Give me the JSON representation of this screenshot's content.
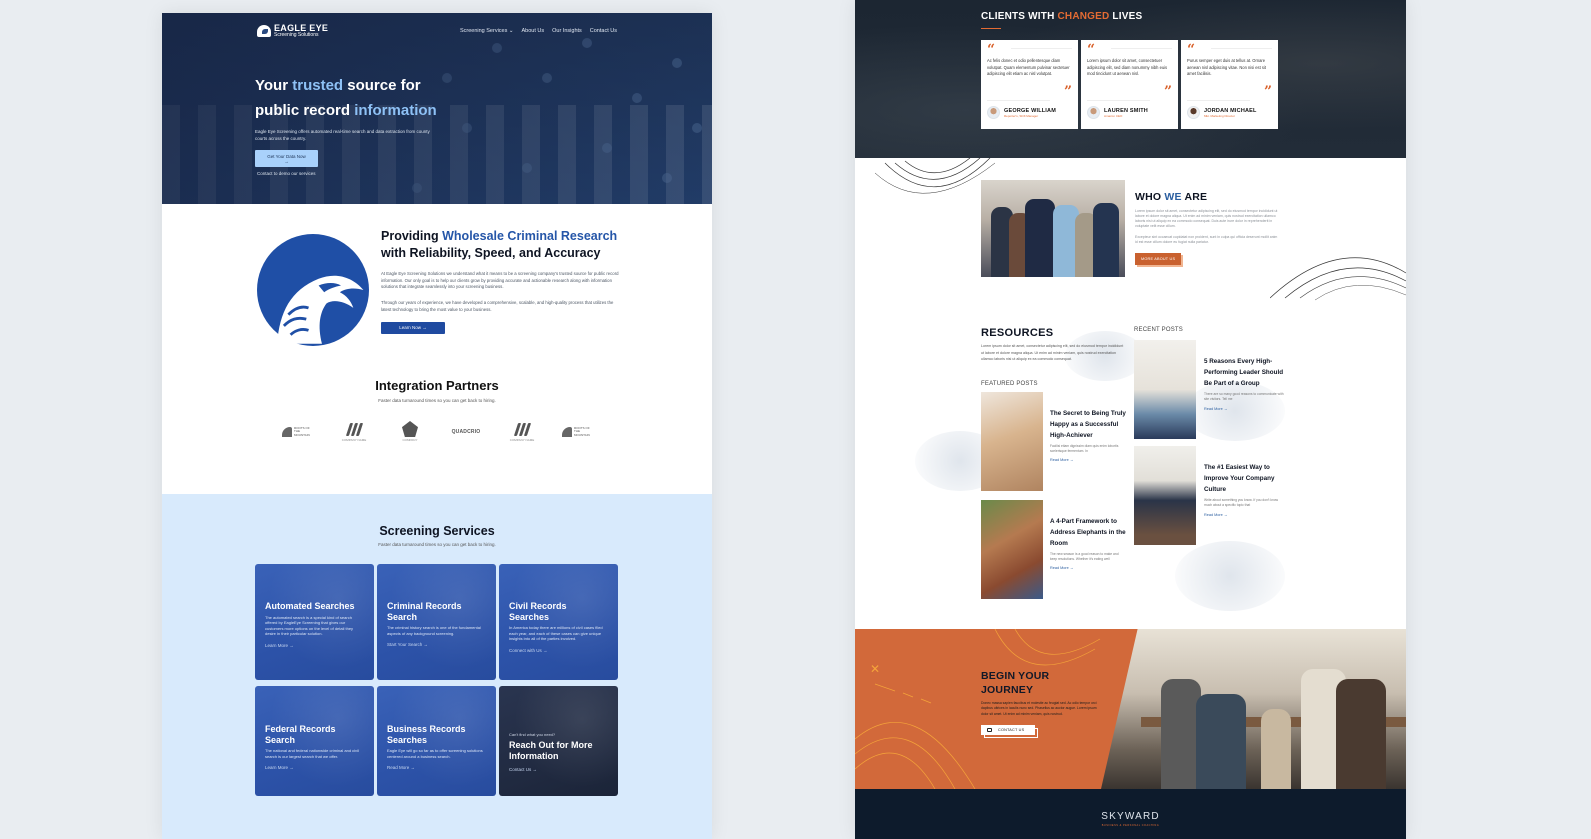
{
  "left_site": {
    "brand": {
      "name": "EAGLE EYE",
      "tagline": "Screening Solutions"
    },
    "nav": [
      {
        "label": "Screening Services",
        "icon": "chevron-down-icon"
      },
      {
        "label": "About Us"
      },
      {
        "label": "Our Insights"
      },
      {
        "label": "Contact Us"
      }
    ],
    "hero": {
      "title_parts": [
        "Your ",
        "trusted",
        " source for",
        "public record ",
        "information"
      ],
      "description": "Eagle Eye Screening offers automated real-time search and data extraction from county courts across the country.",
      "cta_label": "Get Your Data Now →",
      "sub_link": "Contact to demo our services"
    },
    "about": {
      "title_parts": [
        "Providing ",
        "Wholesale Criminal Research",
        "with Reliability, Speed, and Accuracy"
      ],
      "paragraph1": "At Eagle Eye Screening Solutions we understand what it means to be a screening company's trusted source for public record information. Our only goal is to help our clients grow by providing accurate and actionable research along with information solutions that integrate seamlessly into your screening business.",
      "paragraph2": "Through our years of experience, we have developed a comprehensive, scalable, and high-quality process that utilizes the latest technology to bring the most value to your business.",
      "cta_label": "Learn Now →"
    },
    "partners": {
      "title": "Integration Partners",
      "subtitle": "Faster data turnaround times so you can get back to hiring.",
      "logos": [
        {
          "name": "Roots of the Mountain",
          "caption": "ROOTS OF THE MOUNTAIN",
          "kind": "mountain"
        },
        {
          "name": "Partner Slash",
          "caption": "company name",
          "kind": "slash"
        },
        {
          "name": "Pentagon",
          "caption": "company",
          "kind": "pentagon"
        },
        {
          "name": "Quadcrio",
          "caption": "QUADCRIO",
          "kind": "word"
        },
        {
          "name": "Partner Slash 2",
          "caption": "company name",
          "kind": "slash"
        },
        {
          "name": "Roots of the Mountain 2",
          "caption": "ROOTS OF THE MOUNTAIN",
          "kind": "mountain"
        }
      ]
    },
    "services": {
      "title": "Screening Services",
      "subtitle": "Faster data turnaround times so you can get back to hiring.",
      "cards": [
        {
          "title": "Automated Searches",
          "desc": "The automated search is a special kind of search offered by EagleEye Screening that gives our customers more options on the level of detail they desire in their particular solution.",
          "link": "Learn More →"
        },
        {
          "title": "Criminal Records Search",
          "desc": "The criminal history search is one of the fundamental aspects of any background screening.",
          "link": "Start Your Search →"
        },
        {
          "title": "Civil Records Searches",
          "desc": "In America today there are millions of civil cases filed each year, and each of these cases can give unique insights into all of the parties involved.",
          "link": "Connect with Us →"
        },
        {
          "title": "Federal Records Search",
          "desc": "The national and federal nationwide criminal and civil search is our largest search that we offer.",
          "link": "Learn More →"
        },
        {
          "title": "Business Records Searches",
          "desc": "Eagle Eye will go so far as to offer screening solutions centered around a business search.",
          "link": "Read More →"
        },
        {
          "kicker": "Can't find what you need?",
          "title": "Reach Out for More Information",
          "link": "Contact Us →",
          "dark": true
        }
      ]
    }
  },
  "right_site": {
    "testimonials": {
      "title_parts": [
        "CLIENTS WITH ",
        "CHANGED",
        " LIVES"
      ],
      "items": [
        {
          "quote": "Ac felis donec et odio pellentesque diam volutpat. Quam elementum pulvinar sectetuer adipiscing elit etiam ac nisl volutpat.",
          "name": "GEORGE WILLIAM",
          "role": "Reporter's, Shift Manager"
        },
        {
          "quote": "Lorem ipsum dolor sit amet, consectetuer adipiscing elit, sed diam nonummy nibh euis mod tincidunt ut aenean nisl.",
          "name": "LAUREN SMITH",
          "role": "Amazon CEO"
        },
        {
          "quote": "Purus semper eget duis at tellus at. Ornare aenean nisl adipiscing vitae. Non nisi est sit amet facilisis.",
          "name": "JORDAN MICHAEL",
          "role": "Mkt. Marketing Director"
        }
      ]
    },
    "who": {
      "title_parts": [
        "WHO ",
        "WE",
        " ARE"
      ],
      "paragraph1": "Lorem ipsum dolor sit amet, consectetur adipiscing elit, sed do eiusmod tempor incididunt ut labore et dolore magna aliqua. Ut enim ad minim veniam, quis nostrud exercitation ullamco laboris nisi ut aliquip ex ea commodo consequat. Duis aute irure dolor in reprehenderit in voluptate velit esse cillum.",
      "paragraph2": "Excepteur sint occaecat cupidatat non proident, sunt in culpa qui officia deserunt mollit anim id est esse cillum dolore eu fugiat nulla pariatur.",
      "cta_label": "MORE ABOUT US"
    },
    "resources": {
      "title": "RESOURCES",
      "description": "Lorem ipsum dolor sit amet, consectetur adipiscing elit, sed do eiusmod tempor incididunt ut labore et dolore magna aliqua. Ut enim ad minim veniam, quis nostrud exercitation ullamco laboris nisi ut aliquip ex ea commodo consequat.",
      "featured_label": "FEATURED POSTS",
      "recent_label": "RECENT POSTS",
      "featured": [
        {
          "title": "The Secret to Being Truly Happy as a Successful High-Achiever",
          "excerpt": "Facilisi etiam dignissim diam quis enim lobortis scelerisque fermentum. In",
          "link": "Read More →"
        },
        {
          "title": "A 4-Part Framework to Address Elephants in the Room",
          "excerpt": "The new season is a good reason to make and keep resolutions. Whether it's eating well",
          "link": "Read More →"
        }
      ],
      "recent": [
        {
          "title": "5 Reasons Every High-Performing Leader Should Be Part of a Group",
          "excerpt": "There are so many good reasons to communicate with site visitors. Tell me",
          "link": "Read More →"
        },
        {
          "title": "The #1 Easiest Way to Improve Your Company Culture",
          "excerpt": "Write about something you know. If you don't know much about a specific topic that",
          "link": "Read More →"
        }
      ]
    },
    "journey": {
      "title_line1": "BEGIN YOUR",
      "title_line2": "JOURNEY",
      "paragraph": "Donec massa sapien faucibus et molestie ac feugiat sed. Ac odio tempor orci dapibus ultrices in iaculis nunc sed. Phasellus ac auctor augue. Lorem ipsum dolor sit amet. Ut enim ad minim veniam, quis nostrud.",
      "cta_label": "CONTACT US"
    },
    "footer": {
      "brand": "SKYWARD",
      "tagline": "BUSINESS & PERSONAL COACHING"
    },
    "colors": {
      "accent": "#d2693a",
      "navy": "#0d1b2c",
      "blue": "#2c5fa0"
    }
  }
}
